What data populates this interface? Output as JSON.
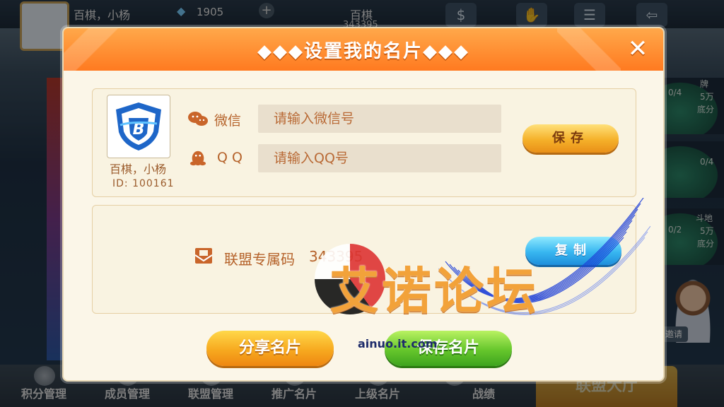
{
  "topbar": {
    "player_name": "百棋，小杨",
    "diamonds": "1905",
    "club_name": "百棋",
    "club_id": "343395",
    "lobby_hint": "大厅"
  },
  "background": {
    "right_tables": [
      {
        "seats": "0/4",
        "name": "牌",
        "rule": "5万",
        "extra": "底分"
      },
      {
        "seats": "0/4",
        "name": "",
        "rule": "",
        "extra": ""
      },
      {
        "seats": "0/2",
        "name": "斗地",
        "rule": "5万",
        "extra": "底分"
      }
    ],
    "invite_label": "邀请",
    "bottom_nav": [
      "积分管理",
      "成员管理",
      "联盟管理",
      "推广名片",
      "上级名片",
      "战绩"
    ],
    "lobby_button": "联盟大厅"
  },
  "dialog": {
    "title": "◆◆◆设置我的名片◆◆◆",
    "close_icon": "close-x-icon",
    "card": {
      "name": "百棋，小杨",
      "id_text": "ID: 100161"
    },
    "wechat": {
      "label": "微信",
      "placeholder": "请输入微信号",
      "value": ""
    },
    "qq": {
      "label": "Q  Q",
      "placeholder": "请输入QQ号",
      "value": ""
    },
    "save_label": "保存",
    "alliance_code_label": "联盟专属码",
    "alliance_code_value": "343395",
    "copy_label": "复制",
    "share_label": "分享名片",
    "keep_label": "保存名片"
  },
  "watermark": {
    "text": "艾诺论坛",
    "url": "ainuo.it.com"
  },
  "colors": {
    "header_orange": "#ff8a2a",
    "label_brown": "#b5622a",
    "gold_button": "#f5b12a",
    "blue_button": "#37b6f0",
    "green_button": "#66c62c"
  }
}
